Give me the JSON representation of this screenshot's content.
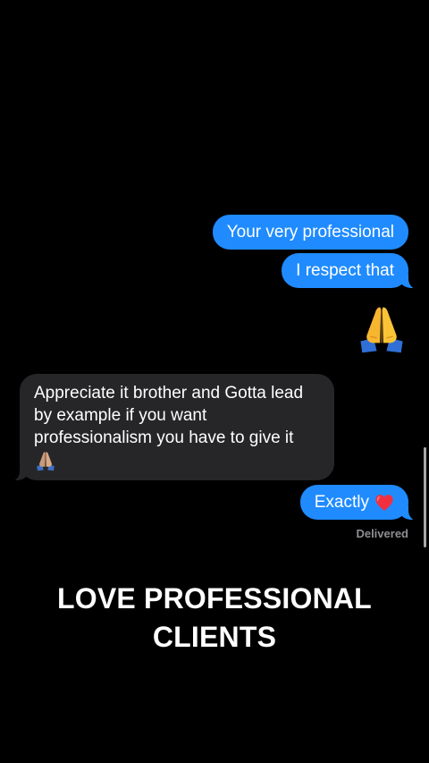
{
  "messages": {
    "sent_1": "Your very professional",
    "sent_2": "I respect that",
    "received_1": "Appreciate it brother and Gotta lead by example if you want professionalism you have to give it",
    "sent_3": "Exactly"
  },
  "status": "Delivered",
  "caption": {
    "line1": "LOVE PROFESSIONAL",
    "line2": "CLIENTS"
  },
  "emoji": {
    "large": "folded-hands-emoji",
    "inline_received": "folded-hands-emoji",
    "inline_sent": "red-heart-emoji"
  },
  "colors": {
    "background": "#000000",
    "sent_bubble": "#1f8bff",
    "received_bubble": "#262628",
    "status_text": "#8e8e93",
    "text": "#ffffff"
  }
}
